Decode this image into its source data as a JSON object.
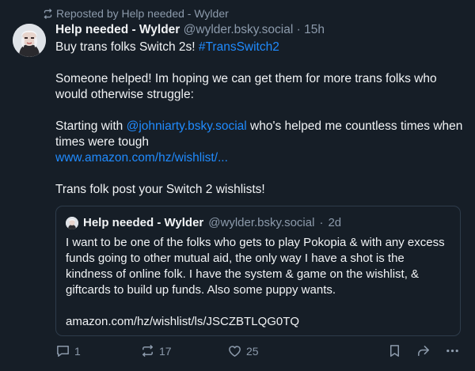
{
  "repost": {
    "label": "Reposted by Help needed - Wylder"
  },
  "post": {
    "author_name": "Help needed - Wylder",
    "author_handle": "@wylder.bsky.social",
    "separator": "·",
    "time": "15h",
    "line1_text": "Buy trans folks Switch 2s! ",
    "line1_tag": "#TransSwitch2",
    "para2": "Someone helped! Im hoping we can get them for more trans folks who would otherwise struggle:",
    "para3_prefix": "Starting with ",
    "para3_mention": "@johniarty.bsky.social",
    "para3_suffix": " who's helped me countless times when times were tough",
    "para3_link": "www.amazon.com/hz/wishlist/...",
    "para4": "Trans folk post your Switch 2 wishlists!"
  },
  "quote": {
    "author_name": "Help needed - Wylder",
    "author_handle": "@wylder.bsky.social",
    "separator": "·",
    "time": "2d",
    "text": "I want to be one of the folks who gets to play Pokopia & with any excess funds going to other mutual aid, the only way I have a shot is the kindness of online folk. I have the system & game on the wishlist, & giftcards to build up funds. Also some puppy wants.",
    "link": "amazon.com/hz/wishlist/ls/JSCZBTLQG0TQ"
  },
  "actions": {
    "reply_count": "1",
    "repost_count": "17",
    "like_count": "25"
  },
  "colors": {
    "background": "#161e27",
    "text": "#f1f3f5",
    "muted": "#8c9aab",
    "link": "#208bfe",
    "border": "#2e3c4b"
  }
}
